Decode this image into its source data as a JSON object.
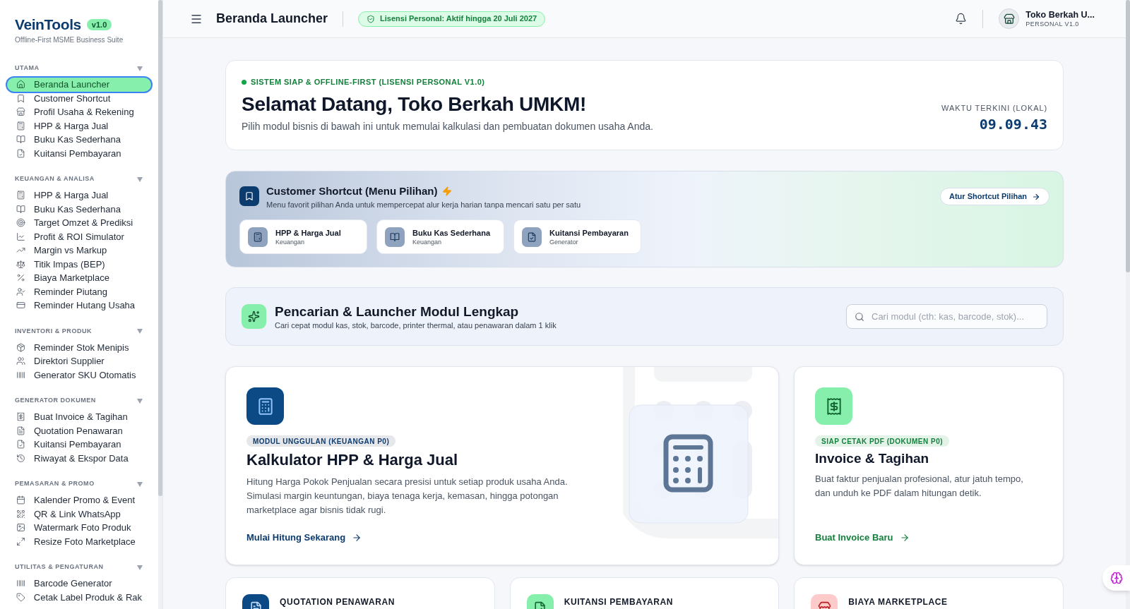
{
  "sidebar": {
    "brand": "VeinTools",
    "version": "v1.0",
    "tagline": "Offline-First MSME Business Suite",
    "sections": [
      {
        "title": "UTAMA",
        "expanded": true,
        "items": [
          {
            "label": "Beranda Launcher",
            "selected": true
          },
          {
            "label": "Customer Shortcut",
            "selected": false
          },
          {
            "label": "Profil Usaha & Rekening",
            "selected": false
          },
          {
            "label": "HPP & Harga Jual",
            "selected": false
          },
          {
            "label": "Buku Kas Sederhana",
            "selected": false
          },
          {
            "label": "Kuitansi Pembayaran",
            "selected": false
          }
        ]
      },
      {
        "title": "KEUANGAN & ANALISA",
        "expanded": true,
        "items": [
          {
            "label": "HPP & Harga Jual",
            "selected": false
          },
          {
            "label": "Buku Kas Sederhana",
            "selected": false
          },
          {
            "label": "Target Omzet & Prediksi",
            "selected": false
          },
          {
            "label": "Profit & ROI Simulator",
            "selected": false
          },
          {
            "label": "Margin vs Markup",
            "selected": false
          },
          {
            "label": "Titik Impas (BEP)",
            "selected": false
          },
          {
            "label": "Biaya Marketplace",
            "selected": false
          },
          {
            "label": "Reminder Piutang",
            "selected": false
          },
          {
            "label": "Reminder Hutang Usaha",
            "selected": false
          }
        ]
      },
      {
        "title": "INVENTORI & PRODUK",
        "expanded": true,
        "items": [
          {
            "label": "Reminder Stok Menipis",
            "selected": false
          },
          {
            "label": "Direktori Supplier",
            "selected": false
          },
          {
            "label": "Generator SKU Otomatis",
            "selected": false
          }
        ]
      },
      {
        "title": "GENERATOR DOKUMEN",
        "expanded": true,
        "items": [
          {
            "label": "Buat Invoice & Tagihan",
            "selected": false
          },
          {
            "label": "Quotation Penawaran",
            "selected": false
          },
          {
            "label": "Kuitansi Pembayaran",
            "selected": false
          },
          {
            "label": "Riwayat & Ekspor Data",
            "selected": false
          }
        ]
      },
      {
        "title": "PEMASARAN & PROMO",
        "expanded": true,
        "items": [
          {
            "label": "Kalender Promo & Event",
            "selected": false
          },
          {
            "label": "QR & Link WhatsApp",
            "selected": false
          },
          {
            "label": "Watermark Foto Produk",
            "selected": false
          },
          {
            "label": "Resize Foto Marketplace",
            "selected": false
          }
        ]
      },
      {
        "title": "UTILITAS & PENGATURAN",
        "expanded": true,
        "items": [
          {
            "label": "Barcode Generator",
            "selected": false
          },
          {
            "label": "Cetak Label Produk & Rak",
            "selected": false
          }
        ]
      }
    ]
  },
  "header": {
    "title": "Beranda Launcher",
    "license": "Lisensi Personal: Aktif hingga 20 Juli 2027",
    "user": {
      "name": "Toko Berkah U...",
      "plan": "PERSONAL V1.0"
    }
  },
  "welcome": {
    "status": "SISTEM SIAP & OFFLINE-FIRST (LISENSI PERSONAL V1.0)",
    "title": "Selamat Datang, Toko Berkah UMKM!",
    "subtitle": "Pilih modul bisnis di bawah ini untuk memulai kalkulasi dan pembuatan dokumen usaha Anda.",
    "clock_label": "WAKTU TERKINI (LOKAL)",
    "clock": "09.09.43"
  },
  "shortcuts": {
    "title": "Customer Shortcut (Menu Pilihan)",
    "subtitle": "Menu favorit pilihan Anda untuk mempercepat alur kerja harian tanpa mencari satu per satu",
    "button": "Atur Shortcut Pilihan",
    "items": [
      {
        "title": "HPP & Harga Jual",
        "category": "Keuangan"
      },
      {
        "title": "Buku Kas Sederhana",
        "category": "Keuangan"
      },
      {
        "title": "Kuitansi Pembayaran",
        "category": "Generator"
      }
    ]
  },
  "search": {
    "title": "Pencarian & Launcher Modul Lengkap",
    "subtitle": "Cari cepat modul kas, stok, barcode, printer thermal, atau penawaran dalam 1 klik",
    "placeholder": "Cari modul (cth: kas, barcode, stok)..."
  },
  "modules": [
    {
      "kind": "featured",
      "badge": "MODUL UNGGULAN (KEUANGAN P0)",
      "title": "Kalkulator HPP & Harga Jual",
      "description": "Hitung Harga Pokok Penjualan secara presisi untuk setiap produk usaha Anda. Simulasi margin keuntungan, biaya tenaga kerja, kemasan, hingga potongan marketplace agar bisnis tidak rugi.",
      "link": "Mulai Hitung Sekarang"
    },
    {
      "kind": "standard",
      "badge": "SIAP CETAK PDF (DOKUMEN P0)",
      "title": "Invoice & Tagihan",
      "description": "Buat faktur penjualan profesional, atur jatuh tempo, dan unduh ke PDF dalam hitungan detik.",
      "link": "Buat Invoice Baru"
    }
  ],
  "more_modules": [
    {
      "title": "QUOTATION PENAWARAN",
      "color": "#0c4a85"
    },
    {
      "title": "KUITANSI PEMBAYARAN",
      "color": "#86efac"
    },
    {
      "title": "BIAYA MARKETPLACE",
      "color": "#fecaca"
    }
  ]
}
